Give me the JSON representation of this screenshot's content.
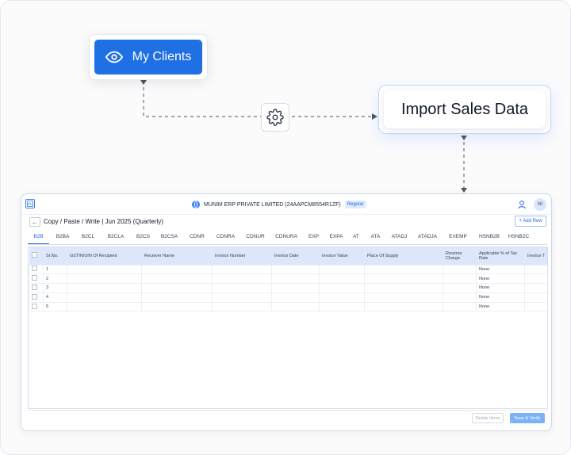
{
  "flow": {
    "my_clients_label": "My Clients",
    "import_label": "Import Sales Data",
    "my_clients_icon": "eye-icon",
    "connector_icon": "gear-icon"
  },
  "app": {
    "company_name": "MUNIM ERP PRIVATE LIMITED (24AAPCM8554R1ZF)",
    "company_badge": "Regular",
    "avatar_initials": "NI",
    "back_label": "←",
    "page_title": "Copy / Paste / Write | Jun 2025 (Quarterly)",
    "add_row_label": "+ Add Row",
    "tabs": [
      "B2B",
      "B2BA",
      "B2CL",
      "B2CLA",
      "B2CS",
      "B2CSA",
      "CDNR",
      "CDNRA",
      "CDNUR",
      "CDNURA",
      "EXP",
      "EXPA",
      "AT",
      "ATA",
      "ATADJ",
      "ATADJA",
      "EXEMP",
      "HSNB2B",
      "HSNB2C"
    ],
    "active_tab": "B2B",
    "columns": [
      "Sr.No.",
      "GSTIN/UIN Of Recipient",
      "Receiver Name",
      "Invoice Number",
      "Invoice Date",
      "Invoice Value",
      "Place Of Supply",
      "Reverse Charge",
      "Applicable % of Tax Rate",
      "Invoice T"
    ],
    "rows": [
      {
        "sr": "1",
        "tax_rate": "None"
      },
      {
        "sr": "2",
        "tax_rate": "None"
      },
      {
        "sr": "3",
        "tax_rate": "None"
      },
      {
        "sr": "4",
        "tax_rate": "None"
      },
      {
        "sr": "5",
        "tax_rate": "None"
      }
    ],
    "delete_label": "Delete Items",
    "save_label": "Save & Verify"
  },
  "colors": {
    "primary": "#1f6fe5",
    "table_header": "#dbe8fb",
    "import_border": "#bcd6fb"
  }
}
